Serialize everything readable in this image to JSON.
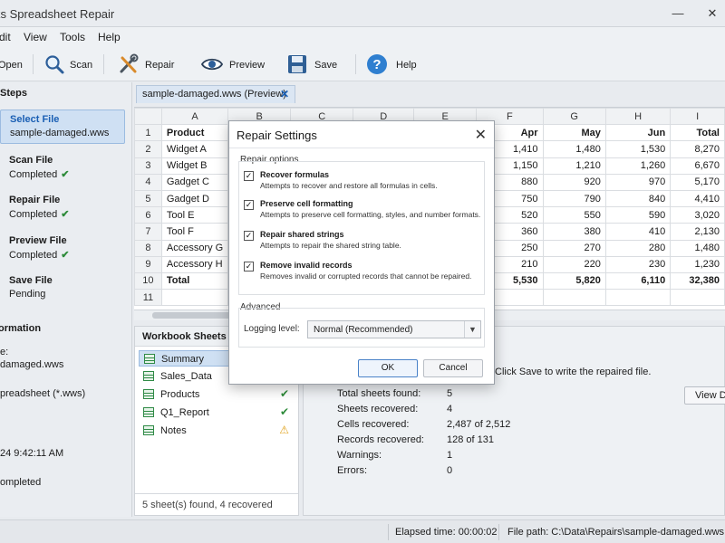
{
  "window": {
    "title": "ks Spreadsheet Repair",
    "minimize": "—",
    "close": "✕"
  },
  "menu": [
    "dit",
    "View",
    "Tools",
    "Help"
  ],
  "toolbar": {
    "open": "Open",
    "scan": "Scan",
    "repair": "Repair",
    "preview": "Preview",
    "save": "Save",
    "help": "Help"
  },
  "left": {
    "steps_heading": "Steps",
    "steps": [
      {
        "name": "Select File",
        "status": "sample-damaged.wws",
        "done": false
      },
      {
        "name": "Scan File",
        "status": "Completed",
        "done": true
      },
      {
        "name": "Repair File",
        "status": "Completed",
        "done": true
      },
      {
        "name": "Preview File",
        "status": "Completed",
        "done": true
      },
      {
        "name": "Save File",
        "status": "Pending",
        "done": false
      }
    ],
    "info_heading": "ormation",
    "info_lines": [
      "e:",
      "damaged.wws",
      "preadsheet (*.wws)",
      "24   9:42:11 AM",
      "ompleted"
    ]
  },
  "tab": {
    "label": "sample-damaged.wws (Preview)",
    "close": "✕"
  },
  "grid": {
    "columns": [
      "A",
      "B",
      "C",
      "D",
      "E",
      "F",
      "G",
      "H",
      "I"
    ],
    "rows": [
      {
        "n": "1",
        "a": "Product",
        "f": "Apr",
        "g": "May",
        "h": "Jun",
        "i": "Total",
        "bold": true
      },
      {
        "n": "2",
        "a": "Widget A",
        "f": "1,410",
        "g": "1,480",
        "h": "1,530",
        "i": "8,270"
      },
      {
        "n": "3",
        "a": "Widget B",
        "f": "1,150",
        "g": "1,210",
        "h": "1,260",
        "i": "6,670"
      },
      {
        "n": "4",
        "a": "Gadget C",
        "f": "880",
        "g": "920",
        "h": "970",
        "i": "5,170"
      },
      {
        "n": "5",
        "a": "Gadget D",
        "f": "750",
        "g": "790",
        "h": "840",
        "i": "4,410"
      },
      {
        "n": "6",
        "a": "Tool E",
        "f": "520",
        "g": "550",
        "h": "590",
        "i": "3,020"
      },
      {
        "n": "7",
        "a": "Tool F",
        "f": "360",
        "g": "380",
        "h": "410",
        "i": "2,130"
      },
      {
        "n": "8",
        "a": "Accessory G",
        "f": "250",
        "g": "270",
        "h": "280",
        "i": "1,480"
      },
      {
        "n": "9",
        "a": "Accessory H",
        "f": "210",
        "g": "220",
        "h": "230",
        "i": "1,230"
      },
      {
        "n": "10",
        "a": "Total",
        "f": "5,530",
        "g": "5,820",
        "h": "6,110",
        "i": "32,380",
        "bold": true
      },
      {
        "n": "11",
        "a": "",
        "f": "",
        "g": "",
        "h": "",
        "i": ""
      }
    ]
  },
  "sheets": {
    "heading": "Workbook Sheets",
    "items": [
      {
        "name": "Summary",
        "status": ""
      },
      {
        "name": "Sales_Data",
        "status": ""
      },
      {
        "name": "Products",
        "status": "✔"
      },
      {
        "name": "Q1_Report",
        "status": "✔"
      },
      {
        "name": "Notes",
        "status": "⚠"
      }
    ],
    "footer": "5 sheet(s) found, 4 recovered"
  },
  "summary": {
    "note": "Click Save to write the repaired file.",
    "view_button": "View De",
    "rows": [
      {
        "label": "Total sheets found:",
        "value": "5"
      },
      {
        "label": "Sheets recovered:",
        "value": "4"
      },
      {
        "label": "Cells recovered:",
        "value": "2,487 of 2,512"
      },
      {
        "label": "Records recovered:",
        "value": "128 of 131"
      },
      {
        "label": "Warnings:",
        "value": "1"
      },
      {
        "label": "Errors:",
        "value": "0"
      }
    ]
  },
  "status": {
    "elapsed": "Elapsed time: 00:00:02",
    "filepath": "File path: C:\\Data\\Repairs\\sample-damaged.wws"
  },
  "dialog": {
    "title": "Repair Settings",
    "close": "✕",
    "group_label": "Repair options",
    "options": [
      {
        "title": "Recover formulas",
        "desc": "Attempts to recover and restore all formulas in cells.",
        "checked": true
      },
      {
        "title": "Preserve cell formatting",
        "desc": "Attempts to preserve cell formatting, styles, and number formats.",
        "checked": true
      },
      {
        "title": "Repair shared strings",
        "desc": "Attempts to repair the shared string table.",
        "checked": true
      },
      {
        "title": "Remove invalid records",
        "desc": "Removes invalid or corrupted records that cannot be repaired.",
        "checked": true
      }
    ],
    "advanced_label": "Advanced",
    "logging_label": "Logging level:",
    "logging_value": "Normal (Recommended)",
    "ok": "OK",
    "cancel": "Cancel",
    "checkmark": "✓"
  },
  "icons": [
    "open-icon",
    "search-icon",
    "repair-tools-icon",
    "eye-icon",
    "floppy-disk-icon",
    "help-icon",
    "sheet-icon",
    "checkmark-icon",
    "warning-icon",
    "chevron-down-icon"
  ]
}
